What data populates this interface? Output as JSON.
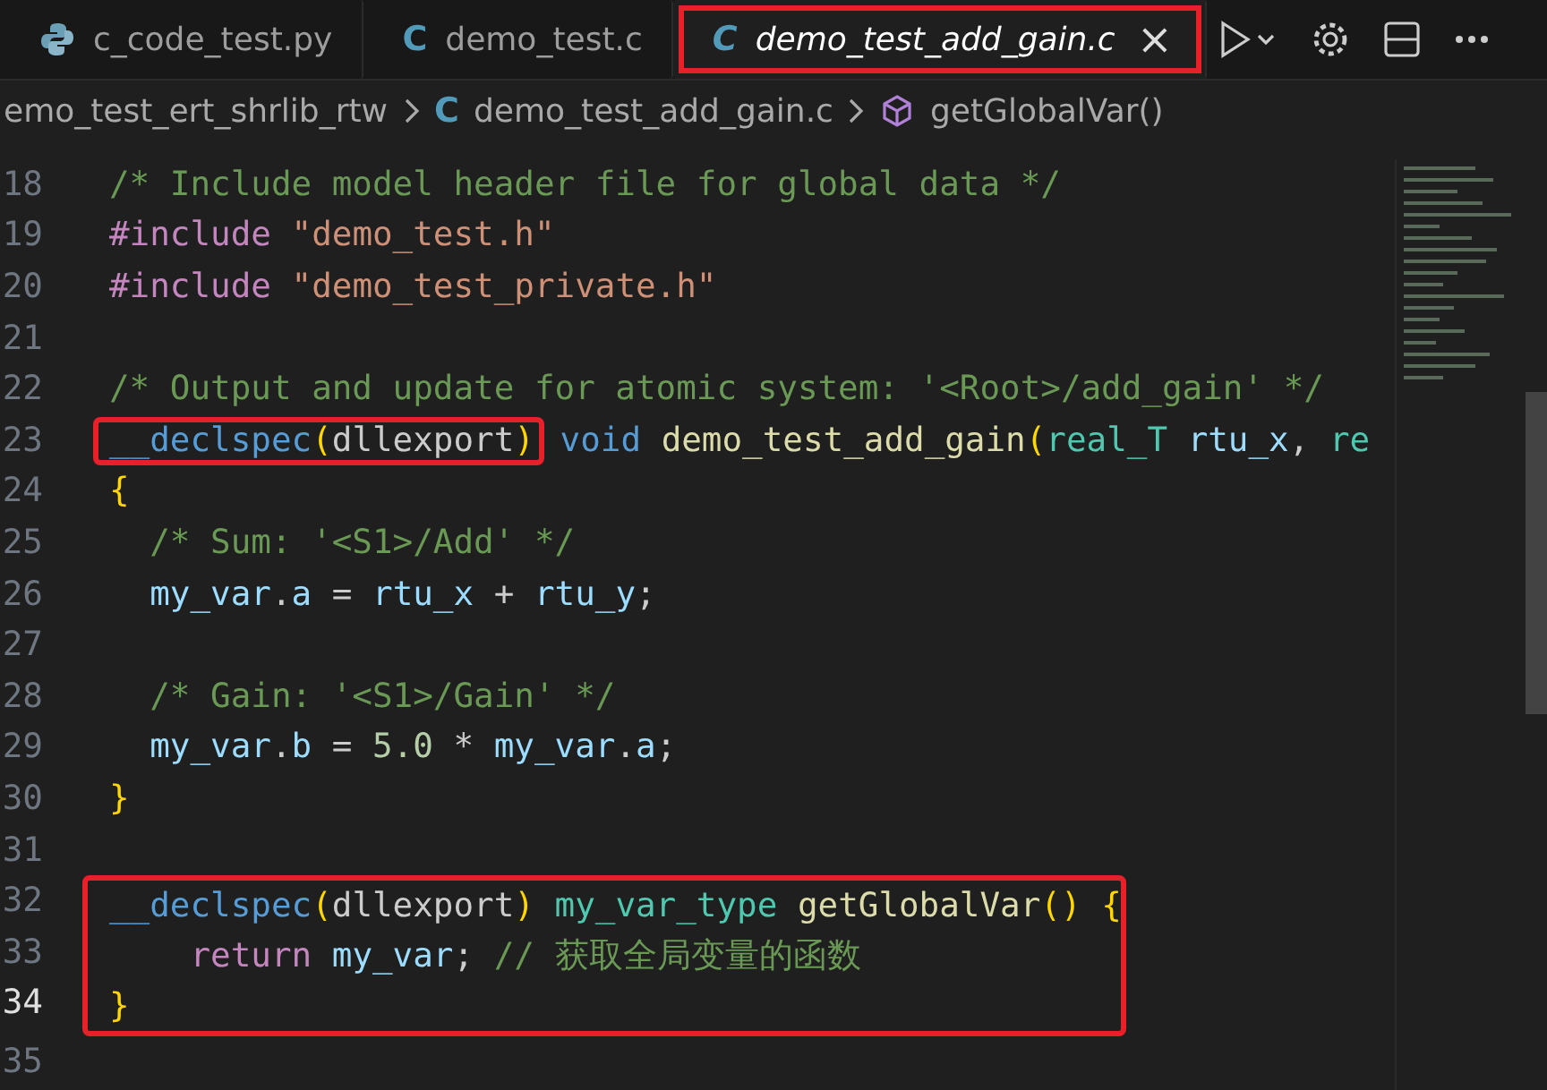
{
  "tabs": [
    {
      "label": "c_code_test.py",
      "kind": "python",
      "selected": false,
      "italic": false,
      "outlined": false
    },
    {
      "label": "demo_test.c",
      "kind": "c",
      "icon_text": "C",
      "selected": false,
      "italic": false,
      "outlined": false
    },
    {
      "label": "demo_test_add_gain.c",
      "kind": "c",
      "icon_text": "C",
      "selected": true,
      "italic": true,
      "outlined": true,
      "close": "×"
    }
  ],
  "breadcrumb": [
    {
      "kind": "folder",
      "text": "emo_test_ert_shrlib_rtw"
    },
    {
      "kind": "file",
      "icon_text": "C",
      "text": "demo_test_add_gain.c"
    },
    {
      "kind": "symbol",
      "text": "getGlobalVar()"
    }
  ],
  "lines": [
    {
      "number": "18",
      "current": false,
      "outlined": false,
      "tokens": [
        {
          "kind": "comment",
          "text": "/* Include model header file for global data */"
        }
      ]
    },
    {
      "number": "19",
      "current": false,
      "outlined": false,
      "tokens": [
        {
          "kind": "keyword",
          "text": "#include"
        },
        {
          "kind": "string",
          "text": " \"demo_test.h\""
        }
      ]
    },
    {
      "number": "20",
      "current": false,
      "outlined": false,
      "tokens": [
        {
          "kind": "keyword",
          "text": "#include"
        },
        {
          "kind": "string",
          "text": " \"demo_test_private.h\""
        }
      ]
    },
    {
      "number": "21",
      "current": false,
      "outlined": false
    },
    {
      "number": "22",
      "current": false,
      "outlined": false,
      "tokens": [
        {
          "kind": "comment",
          "text": "/* Output and update for atomic system: '<Root>/add_gain' */"
        }
      ]
    },
    {
      "number": "23",
      "current": false,
      "outlined": false,
      "tokens": [
        {
          "kind": "storage",
          "text": "__declspec",
          "outlined": true
        },
        {
          "kind": "brace",
          "text": "(",
          "outlined": true
        },
        {
          "kind": "plain",
          "text": "dllexport",
          "outlined": true
        },
        {
          "kind": "brace",
          "text": ")",
          "outlined": true
        },
        {
          "kind": "storage",
          "text": " void"
        },
        {
          "kind": "func",
          "text": " demo_test_add_gain"
        },
        {
          "kind": "brace",
          "text": "("
        },
        {
          "kind": "type",
          "text": "real_T"
        },
        {
          "kind": "variable",
          "text": " rtu_x"
        },
        {
          "kind": "plain",
          "text": ", "
        },
        {
          "kind": "type",
          "text": "re"
        }
      ]
    },
    {
      "number": "24",
      "current": false,
      "outlined": false,
      "tokens": [
        {
          "kind": "brace",
          "text": "{"
        }
      ]
    },
    {
      "number": "25",
      "current": false,
      "outlined": false,
      "tokens": [
        {
          "kind": "comment",
          "text": "  /* Sum: '<S1>/Add' */"
        }
      ]
    },
    {
      "number": "26",
      "current": false,
      "outlined": false,
      "tokens": [
        {
          "kind": "variable",
          "text": "  my_var"
        },
        {
          "kind": "plain",
          "text": "."
        },
        {
          "kind": "variable",
          "text": "a"
        },
        {
          "kind": "plain",
          "text": " = "
        },
        {
          "kind": "variable",
          "text": "rtu_x"
        },
        {
          "kind": "plain",
          "text": " + "
        },
        {
          "kind": "variable",
          "text": "rtu_y"
        },
        {
          "kind": "plain",
          "text": ";"
        }
      ]
    },
    {
      "number": "27",
      "current": false,
      "outlined": false
    },
    {
      "number": "28",
      "current": false,
      "outlined": false,
      "tokens": [
        {
          "kind": "comment",
          "text": "  /* Gain: '<S1>/Gain' */"
        }
      ]
    },
    {
      "number": "29",
      "current": false,
      "outlined": false,
      "tokens": [
        {
          "kind": "variable",
          "text": "  my_var"
        },
        {
          "kind": "plain",
          "text": "."
        },
        {
          "kind": "variable",
          "text": "b"
        },
        {
          "kind": "plain",
          "text": " = "
        },
        {
          "kind": "number",
          "text": "5.0"
        },
        {
          "kind": "plain",
          "text": " * "
        },
        {
          "kind": "variable",
          "text": "my_var"
        },
        {
          "kind": "plain",
          "text": "."
        },
        {
          "kind": "variable",
          "text": "a"
        },
        {
          "kind": "plain",
          "text": ";"
        }
      ]
    },
    {
      "number": "30",
      "current": false,
      "outlined": false,
      "tokens": [
        {
          "kind": "brace",
          "text": "}"
        }
      ]
    },
    {
      "number": "31",
      "current": false,
      "outlined": false
    },
    {
      "number": "32",
      "current": false,
      "outlined": true,
      "tokens": [
        {
          "kind": "storage",
          "text": "__declspec"
        },
        {
          "kind": "brace",
          "text": "("
        },
        {
          "kind": "plain",
          "text": "dllexport"
        },
        {
          "kind": "brace",
          "text": ")"
        },
        {
          "kind": "type",
          "text": " my_var_type"
        },
        {
          "kind": "func",
          "text": " getGlobalVar"
        },
        {
          "kind": "brace",
          "text": "()"
        },
        {
          "kind": "brace",
          "text": " {"
        }
      ]
    },
    {
      "number": "33",
      "current": false,
      "outlined": true,
      "tokens": [
        {
          "kind": "keyword",
          "text": "    return"
        },
        {
          "kind": "variable",
          "text": " my_var"
        },
        {
          "kind": "plain",
          "text": ";"
        },
        {
          "kind": "comment",
          "text": " // 获取全局变量的函数"
        }
      ]
    },
    {
      "number": "34",
      "current": true,
      "outlined": true,
      "tokens": [
        {
          "kind": "brace",
          "text": "}"
        }
      ]
    },
    {
      "number": "35",
      "current": false,
      "outlined": false
    }
  ]
}
